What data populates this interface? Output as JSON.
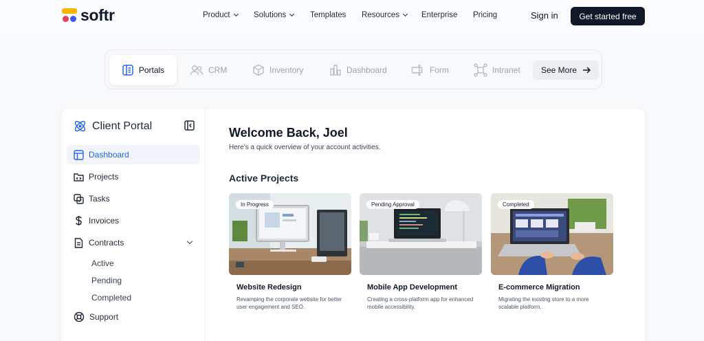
{
  "nav": {
    "brand": "softr",
    "menu": [
      {
        "label": "Product",
        "dropdown": true
      },
      {
        "label": "Solutions",
        "dropdown": true
      },
      {
        "label": "Templates",
        "dropdown": false
      },
      {
        "label": "Resources",
        "dropdown": true
      },
      {
        "label": "Enterprise",
        "dropdown": false
      },
      {
        "label": "Pricing",
        "dropdown": false
      }
    ],
    "sign_in": "Sign in",
    "cta": "Get started free"
  },
  "categories": {
    "tabs": [
      {
        "label": "Portals",
        "icon": "portal-icon",
        "active": true
      },
      {
        "label": "CRM",
        "icon": "users-icon",
        "active": false
      },
      {
        "label": "Inventory",
        "icon": "box-icon",
        "active": false
      },
      {
        "label": "Dashboard",
        "icon": "chart-icon",
        "active": false
      },
      {
        "label": "Form",
        "icon": "form-icon",
        "active": false
      },
      {
        "label": "Intranet",
        "icon": "network-icon",
        "active": false
      }
    ],
    "see_more": "See More"
  },
  "portal": {
    "title": "Client Portal",
    "sidebar": [
      {
        "label": "Dashboard",
        "icon": "layout-icon",
        "active": true
      },
      {
        "label": "Projects",
        "icon": "folder-code-icon"
      },
      {
        "label": "Tasks",
        "icon": "tasks-icon"
      },
      {
        "label": "Invoices",
        "icon": "dollar-icon"
      },
      {
        "label": "Contracts",
        "icon": "document-icon",
        "expanded": true
      }
    ],
    "contract_sub": [
      "Active",
      "Pending",
      "Completed"
    ],
    "support": "Support",
    "welcome": "Welcome Back, Joel",
    "subtitle": "Here’s a quick overview of your account activities.",
    "section_title": "Active Projects",
    "projects": [
      {
        "status": "In Progress",
        "title": "Website Redesign",
        "desc": "Revamping the corporate website for better user engagement and SEO."
      },
      {
        "status": "Pending Approval",
        "title": "Mobile App Development",
        "desc": "Creating a cross-platform app for enhanced mobile accessibility."
      },
      {
        "status": "Completed",
        "title": "E-commerce Migration",
        "desc": "Migrating the existing store to a more scalable platform."
      }
    ]
  },
  "colors": {
    "accent": "#2563eb",
    "cta_bg": "#111827",
    "logo_yellow": "#f7b500",
    "logo_red": "#e83e5c",
    "logo_blue": "#3d5af1"
  }
}
